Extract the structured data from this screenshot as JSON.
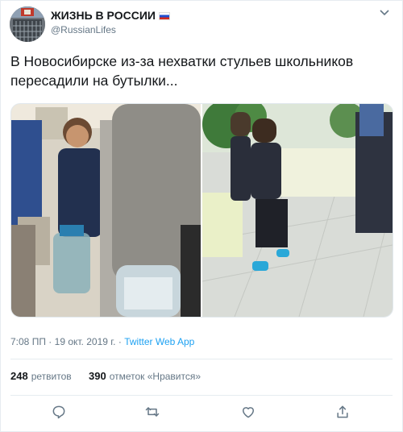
{
  "author": {
    "name": "ЖИЗНЬ В РОССИИ",
    "handle": "@RussianLifes"
  },
  "tweet": {
    "text": "В Новосибирске из-за нехватки стульев школьников пересадили на бутылки..."
  },
  "meta": {
    "time": "7:08 ПП",
    "date": "19 окт. 2019 г.",
    "dot": "·",
    "client": "Twitter Web App"
  },
  "stats": {
    "retweets_count": "248",
    "retweets_label": "ретвитов",
    "likes_count": "390",
    "likes_label": "отметок «Нравится»"
  },
  "icons": {
    "caret": "chevron-down-icon",
    "reply": "reply-icon",
    "retweet": "retweet-icon",
    "like": "heart-icon",
    "share": "share-icon"
  },
  "colors": {
    "link": "#1da1f2",
    "muted": "#657786",
    "text": "#14171a",
    "border": "#e6ecf0"
  }
}
